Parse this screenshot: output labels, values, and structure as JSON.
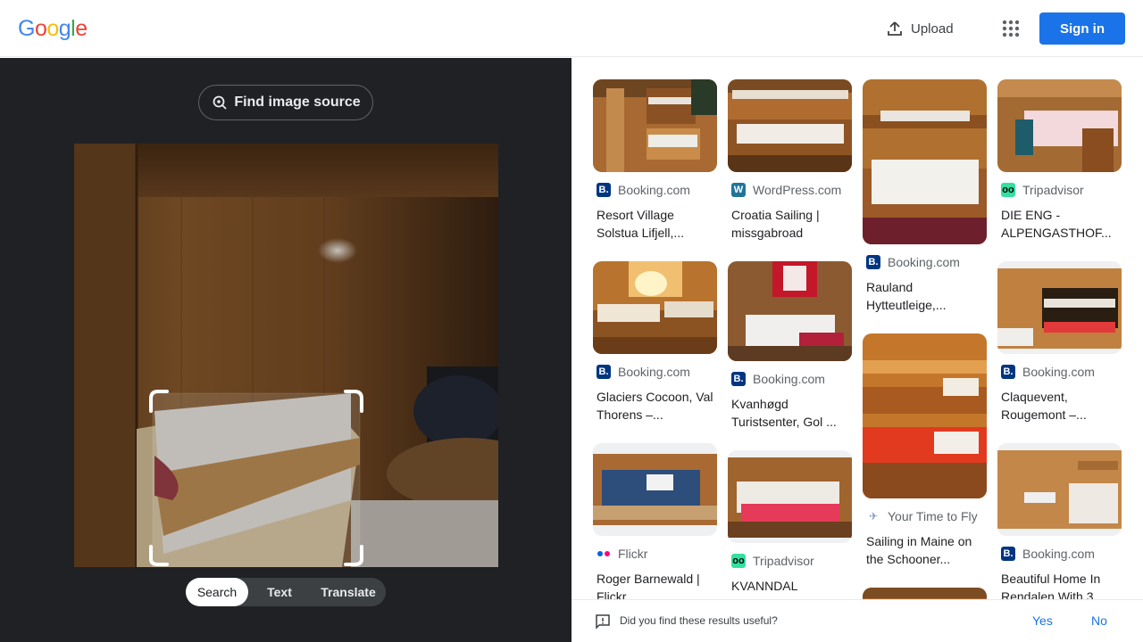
{
  "header": {
    "logo_letters": [
      "G",
      "o",
      "o",
      "g",
      "l",
      "e"
    ],
    "upload_label": "Upload",
    "sign_in_label": "Sign in"
  },
  "lens": {
    "find_source_label": "Find image source",
    "modes": [
      "Search",
      "Text",
      "Translate"
    ],
    "active_mode": "Search"
  },
  "results": [
    [
      {
        "source": "Booking.com",
        "source_icon": "booking-icon",
        "title": "Resort Village Solstua Lifjell,..."
      },
      {
        "source": "Booking.com",
        "source_icon": "booking-icon",
        "title": "Glaciers Cocoon, Val Thorens –..."
      },
      {
        "source": "Flickr",
        "source_icon": "flickr-icon",
        "title": "Roger Barnewald | Flickr"
      }
    ],
    [
      {
        "source": "WordPress.com",
        "source_icon": "wordpress-icon",
        "title": "Croatia Sailing | missgabroad"
      },
      {
        "source": "Booking.com",
        "source_icon": "booking-icon",
        "title": "Kvanhøgd Turistsenter, Gol ..."
      },
      {
        "source": "Tripadvisor",
        "source_icon": "tripadvisor-icon",
        "title": "KVANNDAL CAMPING..."
      }
    ],
    [
      {
        "source": "Booking.com",
        "source_icon": "booking-icon",
        "title": "Rauland Hytteutleige,..."
      },
      {
        "source": "Your Time to Fly",
        "source_icon": "yourtimetofly-icon",
        "title": "Sailing in Maine on the Schooner..."
      },
      {
        "source": "",
        "source_icon": "",
        "title": ""
      }
    ],
    [
      {
        "source": "Tripadvisor",
        "source_icon": "tripadvisor-icon",
        "title": "DIE ENG - ALPENGASTHOF..."
      },
      {
        "source": "Booking.com",
        "source_icon": "booking-icon",
        "title": "Claquevent, Rougemont –..."
      },
      {
        "source": "Booking.com",
        "source_icon": "booking-icon",
        "title": "Beautiful Home In Rendalen With 3..."
      }
    ]
  ],
  "feedback": {
    "question": "Did you find these results useful?",
    "yes": "Yes",
    "no": "No"
  },
  "colors": {
    "accent": "#1a73e8",
    "dark_panel": "#202124"
  }
}
